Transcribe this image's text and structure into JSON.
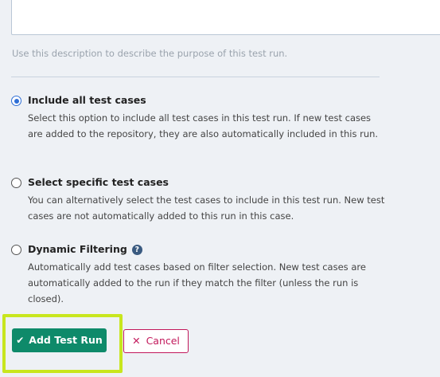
{
  "description": {
    "hint": "Use this description to describe the purpose of this test run."
  },
  "options": [
    {
      "title": "Include all test cases",
      "description": "Select this option to include all test cases in this test run. If new test cases are added to the repository, they are also automatically included in this run.",
      "selected": true
    },
    {
      "title": "Select specific test cases",
      "description": "You can alternatively select the test cases to include in this test run. New test cases are not automatically added to this run in this case.",
      "selected": false
    },
    {
      "title": "Dynamic Filtering",
      "description": "Automatically add test cases based on filter selection. New test cases are automatically added to the run if they match the filter (unless the run is closed).",
      "selected": false,
      "help_icon": "question-circle-icon"
    }
  ],
  "actions": {
    "add_label": "Add Test Run",
    "add_icon": "checkmark-icon",
    "cancel_label": "Cancel",
    "cancel_icon": "x-icon"
  },
  "colors": {
    "primary": "#0e8a6a",
    "danger": "#c2185b",
    "radio_selected": "#2f6fd6",
    "highlight": "#c8e61e"
  }
}
